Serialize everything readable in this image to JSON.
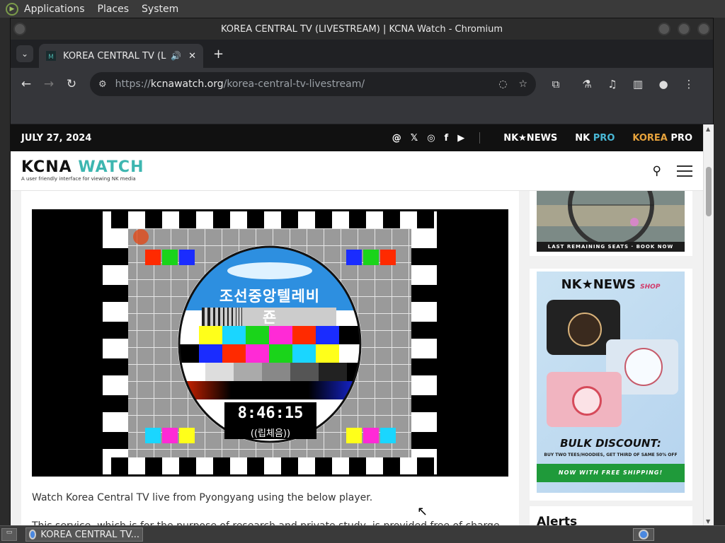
{
  "desktop": {
    "menu": [
      "Applications",
      "Places",
      "System"
    ]
  },
  "window": {
    "title": "KOREA CENTRAL TV (LIVESTREAM) | KCNA Watch - Chromium"
  },
  "tab": {
    "title": "KOREA CENTRAL TV (LIV",
    "new_tab": "+"
  },
  "omnibox": {
    "scheme": "https://",
    "host": "kcnawatch.org",
    "path": "/korea-central-tv-livestream/"
  },
  "site": {
    "date": "JULY 27, 2024",
    "brands": {
      "nknews": "NK★NEWS",
      "nkpro_a": "NK",
      "nkpro_b": "PRO",
      "koreapro_a": "KOREA",
      "koreapro_b": "PRO"
    },
    "logo_a": "KCNA",
    "logo_b": "WATCH",
    "tagline": "A user friendly interface for viewing NK media"
  },
  "video": {
    "station": "조선중앙텔레비죤",
    "clock": "8:46:15",
    "sub": "((립체음))"
  },
  "article": {
    "intro": "Watch Korea Central TV live from Pyongyang using the below player.",
    "intro2": "This service, which is for the purpose of research and private study, is provided free of charge."
  },
  "sidebar": {
    "ad1_caption": "LAST REMAINING SEATS · BOOK NOW",
    "shop_title": "NK★NEWS",
    "shop_tag": "SHOP",
    "bulk": "BULK DISCOUNT:",
    "bulk_sub": "BUY TWO TEES/HOODIES, GET THIRD OF SAME 50% OFF",
    "shipping": "NOW WITH FREE SHIPPING!",
    "alerts": "Alerts"
  },
  "taskbar": {
    "task_label": "KOREA CENTRAL TV..."
  },
  "colors": {
    "accent_teal": "#3db6b0",
    "pro_blue": "#49b8d6",
    "korea_pro": "#e6a23c",
    "ship_green": "#1f9a3a"
  }
}
